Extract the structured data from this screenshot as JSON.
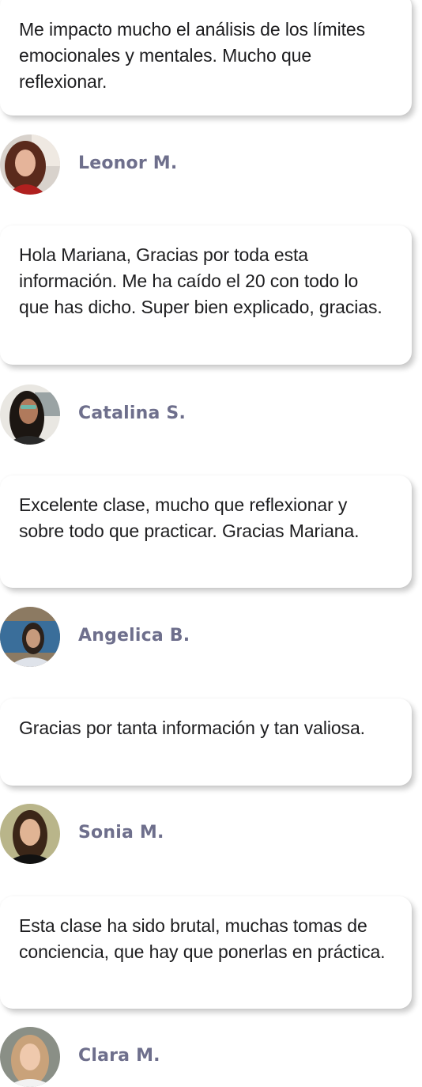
{
  "testimonials": [
    {
      "quote": "Me impacto mucho el análisis de los límites emocionales y mentales. Mucho que reflexionar.",
      "author": "Leonor M."
    },
    {
      "quote": "Hola Mariana, Gracias por toda esta información. Me ha caído el 20 con todo lo que has dicho. Super bien explicado, gracias.",
      "author": "Catalina S."
    },
    {
      "quote": "Excelente clase, mucho que reflexionar y sobre todo que practicar. Gracias Mariana.",
      "author": "Angelica B."
    },
    {
      "quote": "Gracias por tanta información y tan valiosa.",
      "author": "Sonia M."
    },
    {
      "quote": "Esta clase ha sido brutal, muchas tomas de conciencia, que hay que ponerlas en práctica.",
      "author": "Clara M."
    }
  ],
  "colors": {
    "author_name": "#6e6f8c",
    "quote_text": "#1d1d1f",
    "card_bg": "#ffffff"
  }
}
